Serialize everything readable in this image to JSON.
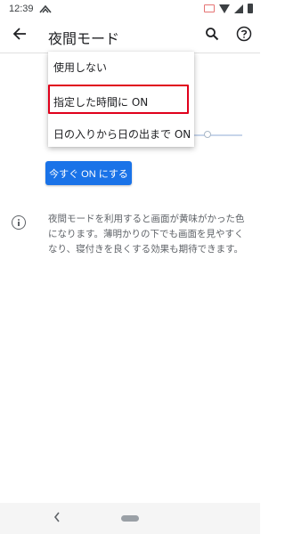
{
  "status": {
    "time": "12:39"
  },
  "header": {
    "title": "夜間モード"
  },
  "dropdown": {
    "items": [
      "使用しない",
      "指定した時間に ON",
      "日の入りから日の出まで ON"
    ]
  },
  "actions": {
    "turn_on_now": "今すぐ ON にする"
  },
  "info": {
    "text": "夜間モードを利用すると画面が黄味がかった色になります。薄明かりの下でも画面を見やすくなり、寝付きを良くする効果も期待できます。"
  },
  "colors": {
    "accent": "#1a73e8",
    "highlight": "#e0001b"
  }
}
